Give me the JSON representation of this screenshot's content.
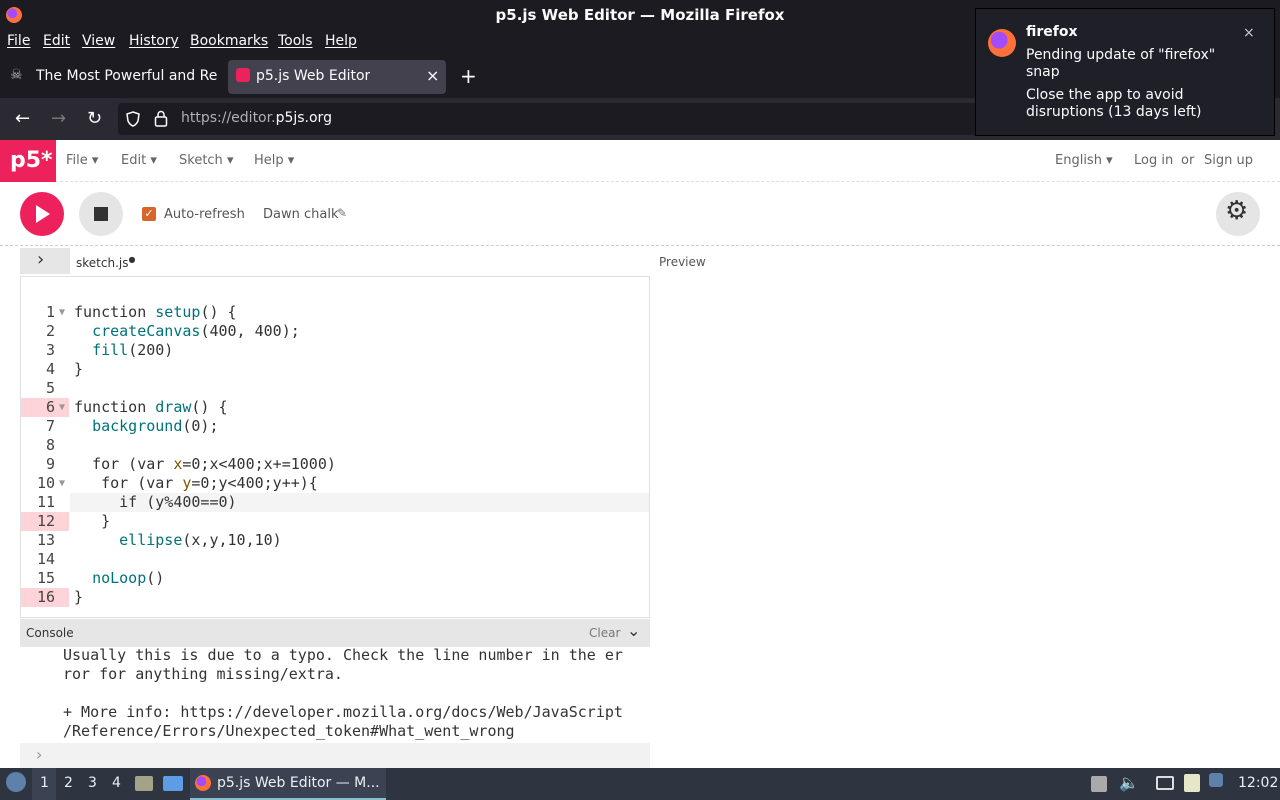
{
  "window": {
    "title": "p5.js Web Editor — Mozilla Firefox"
  },
  "menubar": [
    "File",
    "Edit",
    "View",
    "History",
    "Bookmarks",
    "Tools",
    "Help"
  ],
  "tabs": [
    {
      "label": "The Most Powerful and Re",
      "active": false
    },
    {
      "label": "p5.js Web Editor",
      "active": true
    }
  ],
  "url": {
    "scheme": "https://editor.",
    "domain": "p5js.org"
  },
  "notification": {
    "app": "firefox",
    "line1": "Pending update of \"firefox\"",
    "line2": "snap",
    "line3": "Close the app to avoid",
    "line4": "disruptions (13 days left)"
  },
  "p5": {
    "logo": "p5*",
    "menus": [
      "File",
      "Edit",
      "Sketch",
      "Help"
    ],
    "language": "English",
    "login": "Log in",
    "or": "or",
    "signup": "Sign up",
    "autorefresh_label": "Auto-refresh",
    "autorefresh_checked": true,
    "sketch_name": "Dawn chalk",
    "file_tab": "sketch.js",
    "preview_label": "Preview",
    "console_label": "Console",
    "clear_label": "Clear"
  },
  "code": {
    "line_numbers": [
      "1",
      "2",
      "3",
      "4",
      "5",
      "6",
      "7",
      "8",
      "9",
      "10",
      "11",
      "12",
      "13",
      "14",
      "15",
      "16"
    ],
    "error_lines": [
      6,
      12,
      16
    ],
    "lines": [
      "function setup() {",
      "  createCanvas(400, 400);",
      "  fill(200)",
      "}",
      "",
      "function draw() {",
      "  background(0);",
      "",
      "  for (var x=0;x<400;x+=1000)",
      "   for (var y=0;y<400;y++){",
      "     if (y%400==0)",
      "   }",
      "     ellipse(x,y,10,10)",
      "",
      "  noLoop()",
      "}"
    ]
  },
  "console": {
    "lines": [
      "Usually this is due to a typo. Check the line number in the er",
      "ror for anything missing/extra.",
      "",
      "+ More info: https://developer.mozilla.org/docs/Web/JavaScript",
      "/Reference/Errors/Unexpected_token#What_went_wrong"
    ],
    "prompt": "›"
  },
  "taskbar": {
    "workspaces": [
      "1",
      "2",
      "3",
      "4"
    ],
    "active_window": "p5.js Web Editor — M...",
    "clock": "12:02"
  }
}
